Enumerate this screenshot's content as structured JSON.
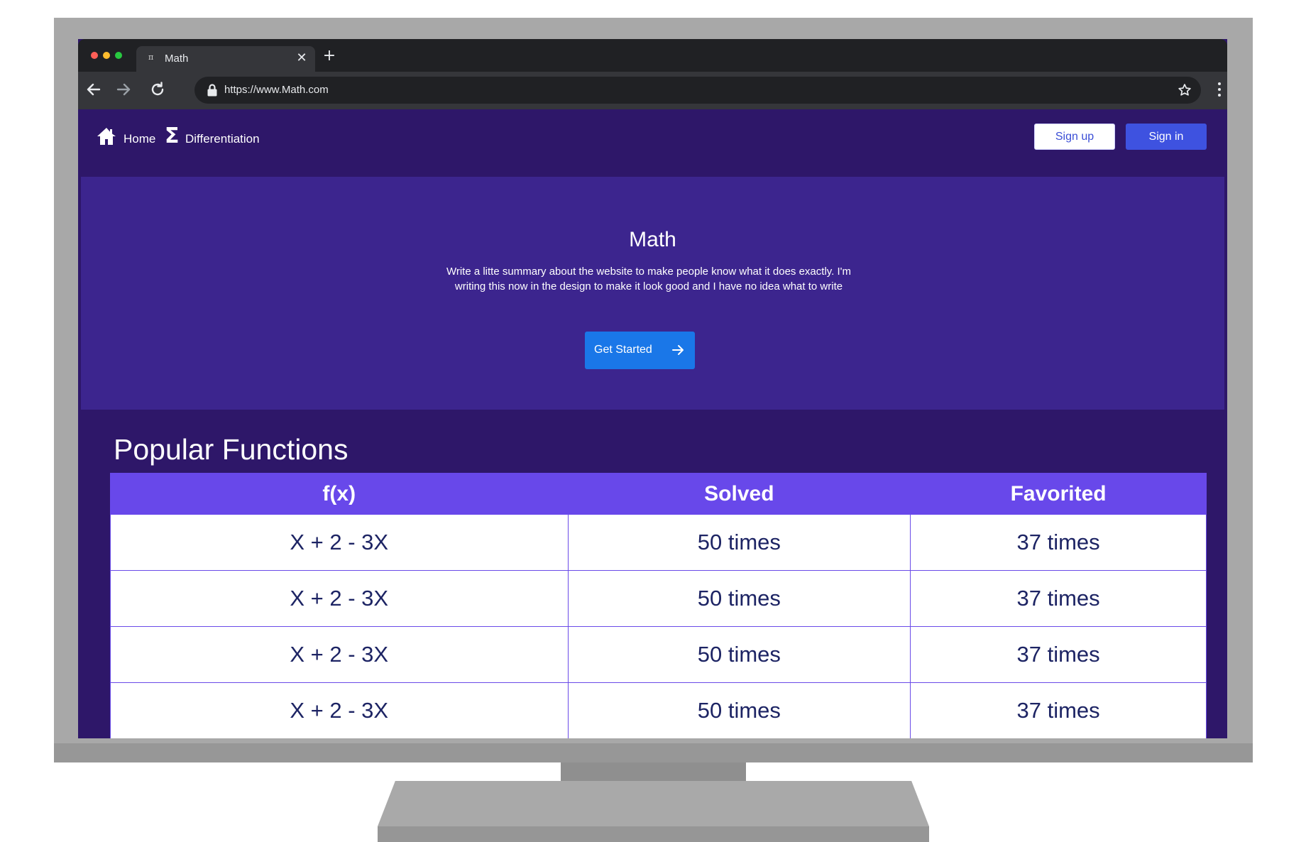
{
  "browser": {
    "tab_title": "Math",
    "tab_favicon": "π",
    "url": "https://www.Math.com"
  },
  "nav": {
    "home_label": "Home",
    "differentiation_label": "Differentiation",
    "signup_label": "Sign up",
    "signin_label": "Sign in"
  },
  "hero": {
    "title": "Math",
    "summary": "Write a litte summary about the website to make people know what it does exactly. I'm writing this now in the design to make it look good and I have no idea what to write",
    "cta_label": "Get Started"
  },
  "popular": {
    "title": "Popular Functions",
    "headers": [
      "f(x)",
      "Solved",
      "Favorited"
    ],
    "rows": [
      [
        "X + 2 - 3X",
        "50 times",
        "37 times"
      ],
      [
        "X + 2 - 3X",
        "50 times",
        "37 times"
      ],
      [
        "X + 2 - 3X",
        "50 times",
        "37 times"
      ],
      [
        "X + 2 - 3X",
        "50 times",
        "37 times"
      ]
    ]
  },
  "colors": {
    "page_bg": "#2e1769",
    "hero_bg": "#3c258e",
    "table_header_bg": "#6848ea",
    "signin_bg": "#3e52e0",
    "cta_bg": "#1a77e8",
    "table_text": "#1d2464"
  }
}
